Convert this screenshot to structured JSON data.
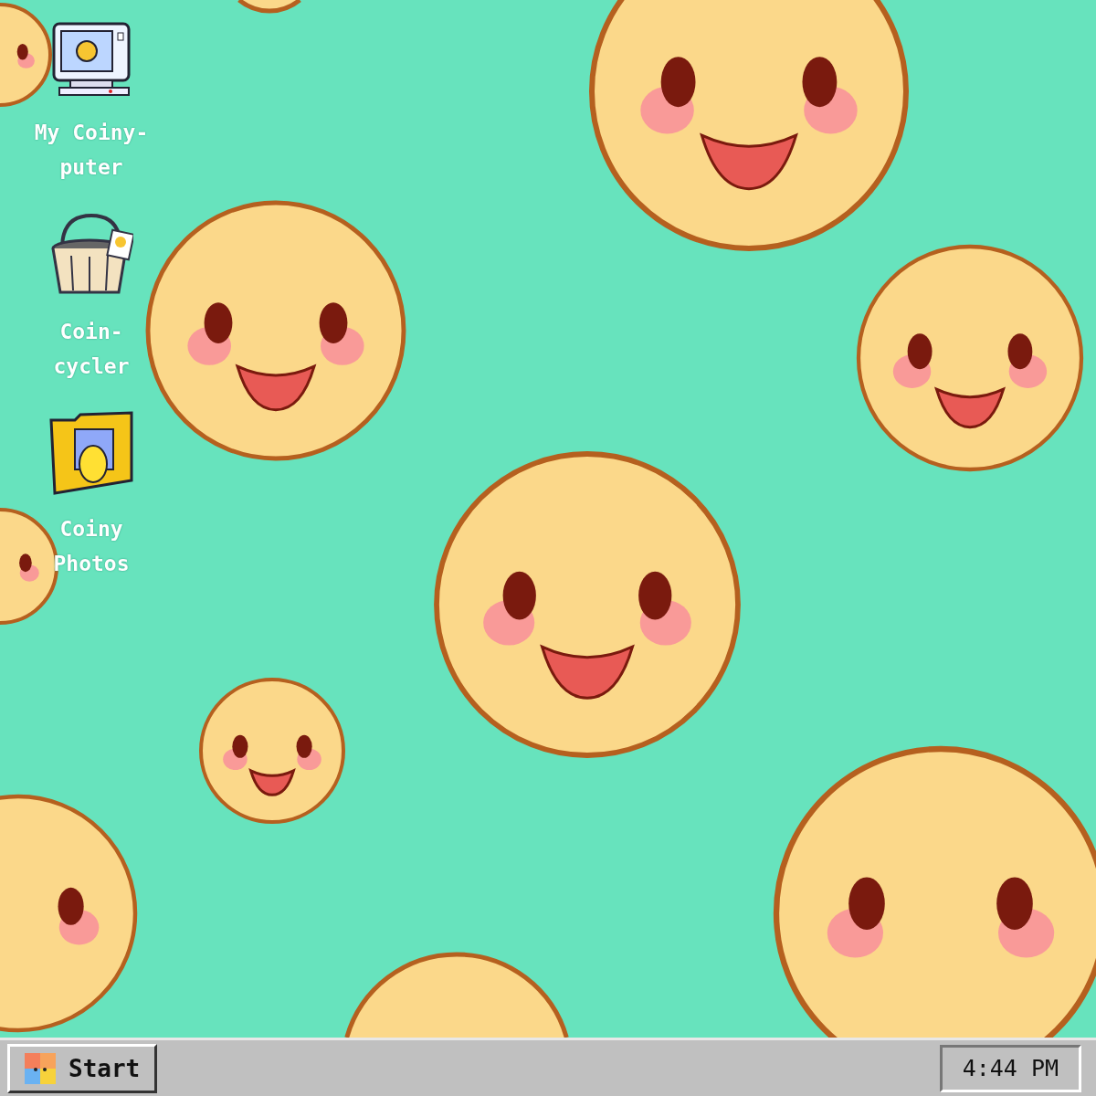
{
  "desktop": {
    "icons": [
      {
        "kind": "computer",
        "label": "My Coiny-puter"
      },
      {
        "kind": "bin",
        "label": "Coin-cycler"
      },
      {
        "kind": "folder",
        "label": "Coiny Photos"
      }
    ]
  },
  "taskbar": {
    "start_button": {
      "label": "Start"
    },
    "clock": "4:44 PM"
  }
}
